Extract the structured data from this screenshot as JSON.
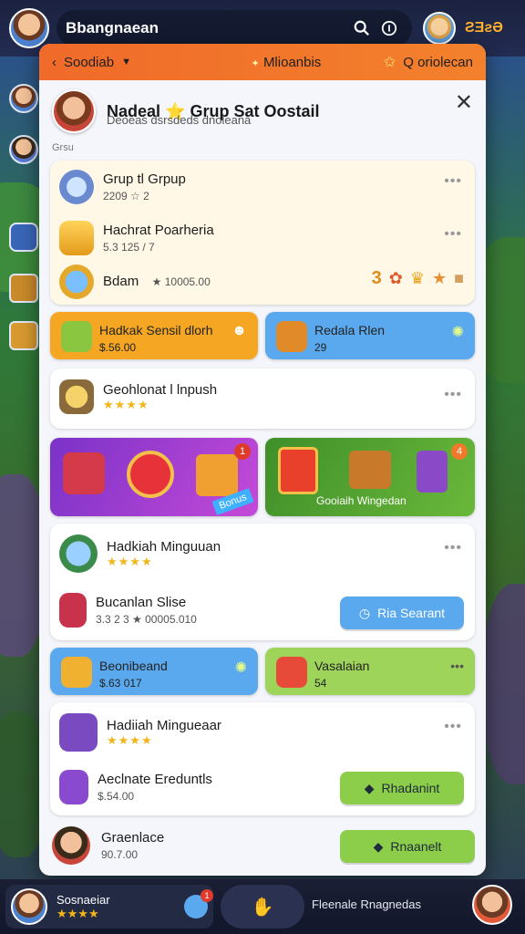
{
  "topbar": {
    "title": "Bbangnaean",
    "coins": "ƧƎƨƏ"
  },
  "modal": {
    "header": {
      "left_label": "Soodiab",
      "center_label": "Mlioanbis",
      "right_label": "Q oriolecan"
    },
    "group": {
      "title": "Nadeal ⭐ Grup Sat Oostail",
      "subtitle": "Deoeas dsrsdeds dnoleana",
      "section": "Grsu"
    },
    "card1": {
      "items": [
        {
          "title": "Grup tl Grpup",
          "sub": "2209 ☆ 2"
        },
        {
          "title": "Hachrat Poarheria",
          "sub": "5.3 125 / 7"
        },
        {
          "title": "Bdam",
          "sub": "★ 10005.00"
        }
      ],
      "reward_count": "3"
    },
    "tiles_row1": [
      {
        "title": "Hadkak Sensil dlorh",
        "sub": "$.56.00",
        "color": "#f5a623"
      },
      {
        "title": "Redala Rlen",
        "sub": "29",
        "color": "#5aa9ee"
      }
    ],
    "card_geoh": {
      "title": "Geohlonat l lnpush",
      "stars": "★★★★"
    },
    "banners": [
      {
        "badge": "1",
        "ribbon": "Bonus",
        "color": "#8a3fd6"
      },
      {
        "badge": "4",
        "caption": "Gooiaih Wingedan",
        "color": "#4a9a2e"
      }
    ],
    "card_weekly": {
      "title": "Hadkiah Minguuan",
      "stars": "★★★★",
      "sub_title": "Bucanlan Slise",
      "sub_sub": "3.3 2 3 ★ 00005.010",
      "button": "Ria Searant"
    },
    "tiles_row2": [
      {
        "title": "Beonibeand",
        "sub": "$.63 017",
        "color": "#5aa9ee"
      },
      {
        "title": "Vasalaian",
        "sub": "54",
        "color": "#9ed45a"
      }
    ],
    "card_weekly2": {
      "title": "Hadiiah Mingueaar",
      "stars": "★★★★",
      "sub_title": "Aeclnate Ereduntls",
      "sub_sub": "$.54.00",
      "button": "Rhadanint"
    },
    "last_row": {
      "title": "Graenlace",
      "sub": "90.7.00",
      "button": "Rnaanelt"
    }
  },
  "bottombar": {
    "user_name": "Sosnaeiar",
    "user_stars": "★★★★",
    "notif": "1",
    "text": "Fleenale Rnagnedas"
  }
}
